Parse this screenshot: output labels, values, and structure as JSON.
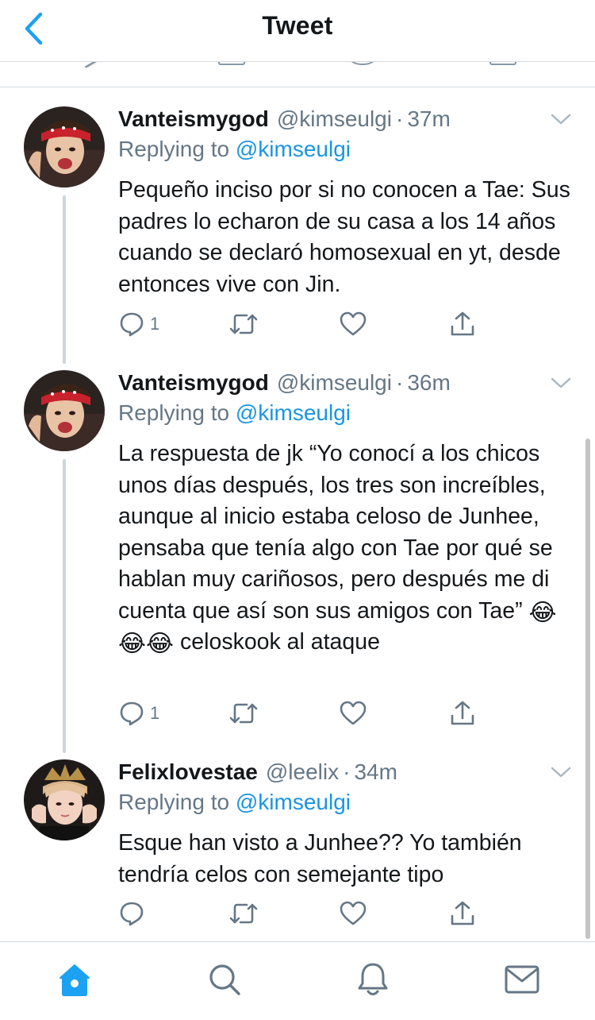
{
  "header": {
    "title": "Tweet",
    "back_icon": "chevron-left-icon"
  },
  "colors": {
    "accent": "#1da1f2",
    "link": "#1b95e0",
    "muted": "#657786",
    "text": "#14171a",
    "divider": "#ccd6dd"
  },
  "tweets": [
    {
      "display_name": "Vanteismygod",
      "handle": "@kimseulgi",
      "separator": "·",
      "time": "37m",
      "replying_to_label": "Replying to",
      "replying_to_handle": "@kimseulgi",
      "text": "Pequeño inciso por si no conocen a Tae: Sus padres lo echaron de su casa a los 14 años cuando se declaró homosexual en yt, desde entonces vive con Jin.",
      "reply_count": "1",
      "retweet_count": "",
      "like_count": ""
    },
    {
      "display_name": "Vanteismygod",
      "handle": "@kimseulgi",
      "separator": "·",
      "time": "36m",
      "replying_to_label": "Replying to",
      "replying_to_handle": "@kimseulgi",
      "text_before_emoji": "La respuesta de jk “Yo conocí a los chicos unos días después, los tres son increíbles, aunque al inicio estaba celoso de Junhee, pensaba que tenía algo con Tae por qué se hablan muy cariñosos, pero después me di cuenta que así son sus amigos con Tae”",
      "emoji": "😂😂😂",
      "text_after_emoji": "celoskook al ataque",
      "reply_count": "1",
      "retweet_count": "",
      "like_count": ""
    },
    {
      "display_name": "Felixlovestae",
      "handle": "@leelix",
      "separator": "·",
      "time": "34m",
      "replying_to_label": "Replying to",
      "replying_to_handle": "@kimseulgi",
      "text": "Esque han visto a Junhee?? Yo también tendría celos con semejante tipo",
      "reply_count": "",
      "retweet_count": "",
      "like_count": ""
    }
  ],
  "tabbar": {
    "items": [
      {
        "name": "home",
        "icon": "home-icon",
        "active": true
      },
      {
        "name": "search",
        "icon": "search-icon",
        "active": false
      },
      {
        "name": "notifications",
        "icon": "bell-icon",
        "active": false
      },
      {
        "name": "messages",
        "icon": "mail-icon",
        "active": false
      }
    ]
  }
}
